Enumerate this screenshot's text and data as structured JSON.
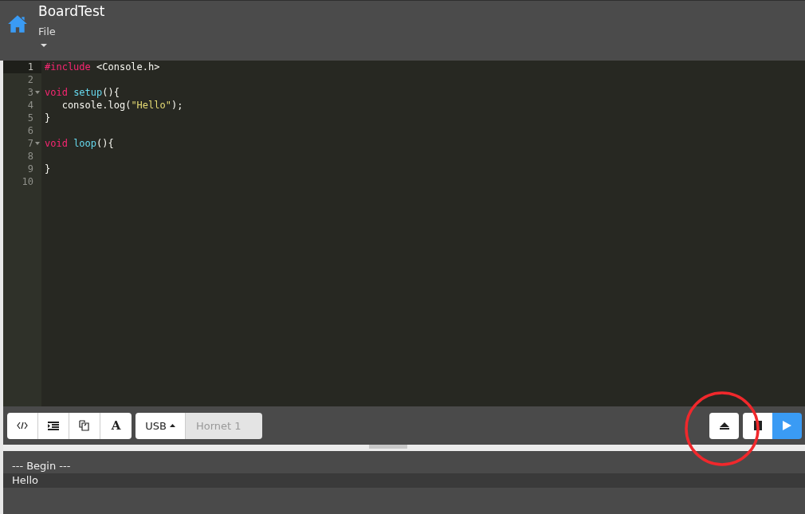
{
  "header": {
    "title": "BoardTest",
    "menu": "File"
  },
  "editor": {
    "lines": [
      {
        "number": "1",
        "active": true,
        "fold": false,
        "tokens": [
          {
            "text": "#include",
            "kind": "keyword"
          },
          {
            "text": " <Console.h>",
            "kind": "plain"
          }
        ]
      },
      {
        "number": "2",
        "active": false,
        "fold": false
      },
      {
        "number": "3",
        "active": false,
        "fold": true,
        "tokens": [
          {
            "text": "void ",
            "kind": "keyword"
          },
          {
            "text": "setup",
            "kind": "function"
          },
          {
            "text": "(){",
            "kind": "plain"
          }
        ]
      },
      {
        "number": "4",
        "active": false,
        "fold": false,
        "tokens": [
          {
            "text": "   console.log(",
            "kind": "plain"
          },
          {
            "text": "\"Hello\"",
            "kind": "string"
          },
          {
            "text": ");",
            "kind": "plain"
          }
        ]
      },
      {
        "number": "5",
        "active": false,
        "fold": false,
        "tokens": [
          {
            "text": "}",
            "kind": "plain"
          }
        ]
      },
      {
        "number": "6",
        "active": false,
        "fold": false
      },
      {
        "number": "7",
        "active": false,
        "fold": true,
        "tokens": [
          {
            "text": "void ",
            "kind": "keyword"
          },
          {
            "text": "loop",
            "kind": "function"
          },
          {
            "text": "(){",
            "kind": "plain"
          }
        ]
      },
      {
        "number": "8",
        "active": false,
        "fold": false
      },
      {
        "number": "9",
        "active": false,
        "fold": false,
        "tokens": [
          {
            "text": "}",
            "kind": "plain"
          }
        ]
      },
      {
        "number": "10",
        "active": false,
        "fold": false
      }
    ]
  },
  "toolbar": {
    "tools": [
      {
        "kind": "code"
      },
      {
        "kind": "indent"
      },
      {
        "kind": "copy"
      },
      {
        "kind": "font",
        "label": "A"
      }
    ],
    "port": {
      "label": "USB"
    },
    "device": {
      "value": "Hornet 1",
      "disabled": true
    },
    "actions": [
      {
        "kind": "eject",
        "primary": false
      },
      {
        "kind": "stop",
        "primary": false
      },
      {
        "kind": "run",
        "primary": true
      }
    ]
  },
  "console": {
    "lines": [
      {
        "text": "--- Begin ---",
        "shaded": false
      },
      {
        "text": "Hello",
        "shaded": true
      }
    ]
  }
}
